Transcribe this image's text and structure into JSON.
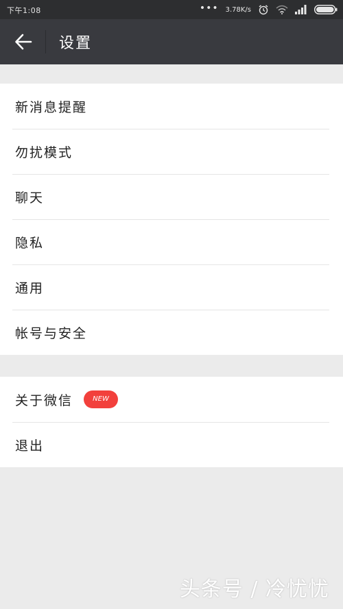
{
  "status_bar": {
    "time": "下午1:08",
    "dots": "•••",
    "speed": "3.78K/s",
    "icons": [
      "alarm-icon",
      "wifi-icon",
      "signal-icon",
      "battery-icon"
    ]
  },
  "toolbar": {
    "back_icon": "arrow-left-icon",
    "title": "设置"
  },
  "menu_group_1": [
    {
      "label": "新消息提醒"
    },
    {
      "label": "勿扰模式"
    },
    {
      "label": "聊天"
    },
    {
      "label": "隐私"
    },
    {
      "label": "通用"
    },
    {
      "label": "帐号与安全"
    }
  ],
  "menu_group_2": [
    {
      "label": "关于微信",
      "badge": "NEW"
    },
    {
      "label": "退出"
    }
  ],
  "watermark": "头条号 / 冷忧忧",
  "colors": {
    "toolbar": "#393a3f",
    "status_bar": "#2d2e30",
    "background": "#ebebeb",
    "badge": "#f2403c"
  }
}
